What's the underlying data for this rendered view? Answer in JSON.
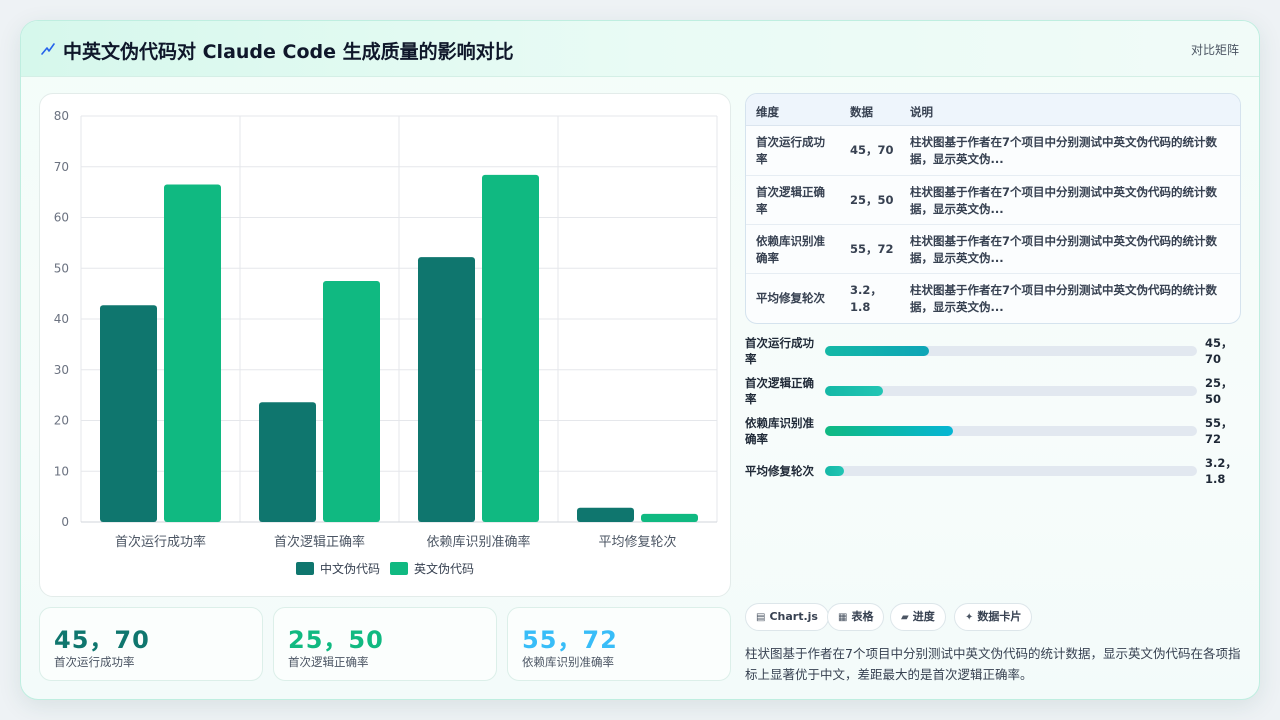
{
  "header": {
    "title": "中英文伪代码对 Claude Code 生成质量的影响对比",
    "mode_label": "对比矩阵"
  },
  "colors": {
    "cn": "#0f766e",
    "en": "#10b981",
    "stat1": "#0f766e",
    "stat2": "#10b981",
    "stat3": "#38bdf8"
  },
  "chart_data": {
    "type": "bar",
    "categories": [
      "首次运行成功率",
      "首次逻辑正确率",
      "依赖库识别准确率",
      "平均修复轮次"
    ],
    "series": [
      {
        "name": "中文伪代码",
        "values": [
          42.7,
          23.6,
          52.2,
          2.8
        ]
      },
      {
        "name": "英文伪代码",
        "values": [
          66.5,
          47.5,
          68.4,
          1.6
        ]
      }
    ],
    "ylim": [
      0,
      80
    ],
    "yticks": [
      "0",
      "10",
      "20",
      "30",
      "40",
      "50",
      "60",
      "70",
      "80"
    ],
    "grid": true,
    "legend_position": "bottom"
  },
  "stats": [
    {
      "value": "45，70",
      "label": "首次运行成功率"
    },
    {
      "value": "25，50",
      "label": "首次逻辑正确率"
    },
    {
      "value": "55，72",
      "label": "依赖库识别准确率"
    }
  ],
  "table": {
    "headers": [
      "维度",
      "数据",
      "说明"
    ],
    "rows": [
      {
        "dim": "首次运行成功率",
        "data": "45，70",
        "desc": "柱状图基于作者在7个项目中分别测试中英文伪代码的统计数据，显示英文伪..."
      },
      {
        "dim": "首次逻辑正确率",
        "data": "25，50",
        "desc": "柱状图基于作者在7个项目中分别测试中英文伪代码的统计数据，显示英文伪..."
      },
      {
        "dim": "依赖库识别准确率",
        "data": "55，72",
        "desc": "柱状图基于作者在7个项目中分别测试中英文伪代码的统计数据，显示英文伪..."
      },
      {
        "dim": "平均修复轮次",
        "data": "3.2，1.8",
        "desc": "柱状图基于作者在7个项目中分别测试中英文伪代码的统计数据，显示英文伪..."
      }
    ]
  },
  "progress": [
    {
      "label": "首次运行成功率",
      "value": "45，70",
      "fraction": 0.28
    },
    {
      "label": "首次逻辑正确率",
      "value": "25，50",
      "fraction": 0.155
    },
    {
      "label": "依赖库识别准确率",
      "value": "55，72",
      "fraction": 0.345
    },
    {
      "label": "平均修复轮次",
      "value": "3.2，1.8",
      "fraction": 0.05
    }
  ],
  "chips": [
    {
      "icon": "chart-icon",
      "label": "Chart.js"
    },
    {
      "icon": "table-icon",
      "label": "表格"
    },
    {
      "icon": "progress-icon",
      "label": "进度"
    },
    {
      "icon": "card-icon",
      "label": "数据卡片"
    }
  ],
  "summary": "柱状图基于作者在7个项目中分别测试中英文伪代码的统计数据，显示英文伪代码在各项指标上显著优于中文，差距最大的是首次逻辑正确率。"
}
